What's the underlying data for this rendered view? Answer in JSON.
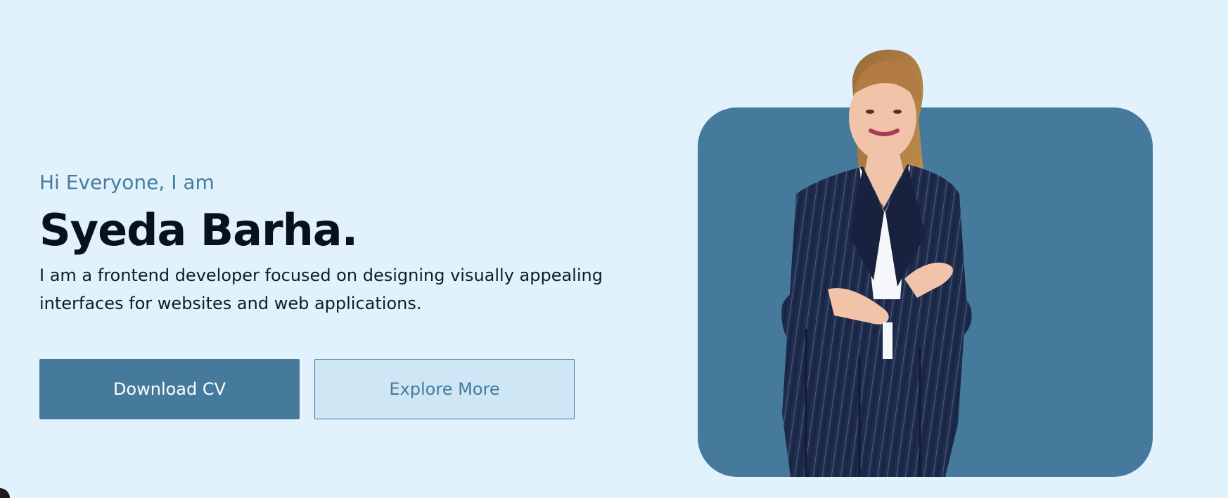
{
  "hero": {
    "greeting": "Hi Everyone, I am",
    "name": "Syeda Barha.",
    "description": "I am a frontend developer focused on designing visually appealing interfaces for websites and web applications.",
    "buttons": {
      "primary_label": "Download CV",
      "secondary_label": "Explore More"
    },
    "portrait": {
      "alt": "Syeda Barha portrait"
    }
  },
  "colors": {
    "background": "#e1f2fd",
    "accent": "#467a9d",
    "secondary_button_bg": "#cfe6f5",
    "heading_text": "#06121c"
  },
  "icons": {
    "corner": "floating-action-dot"
  }
}
